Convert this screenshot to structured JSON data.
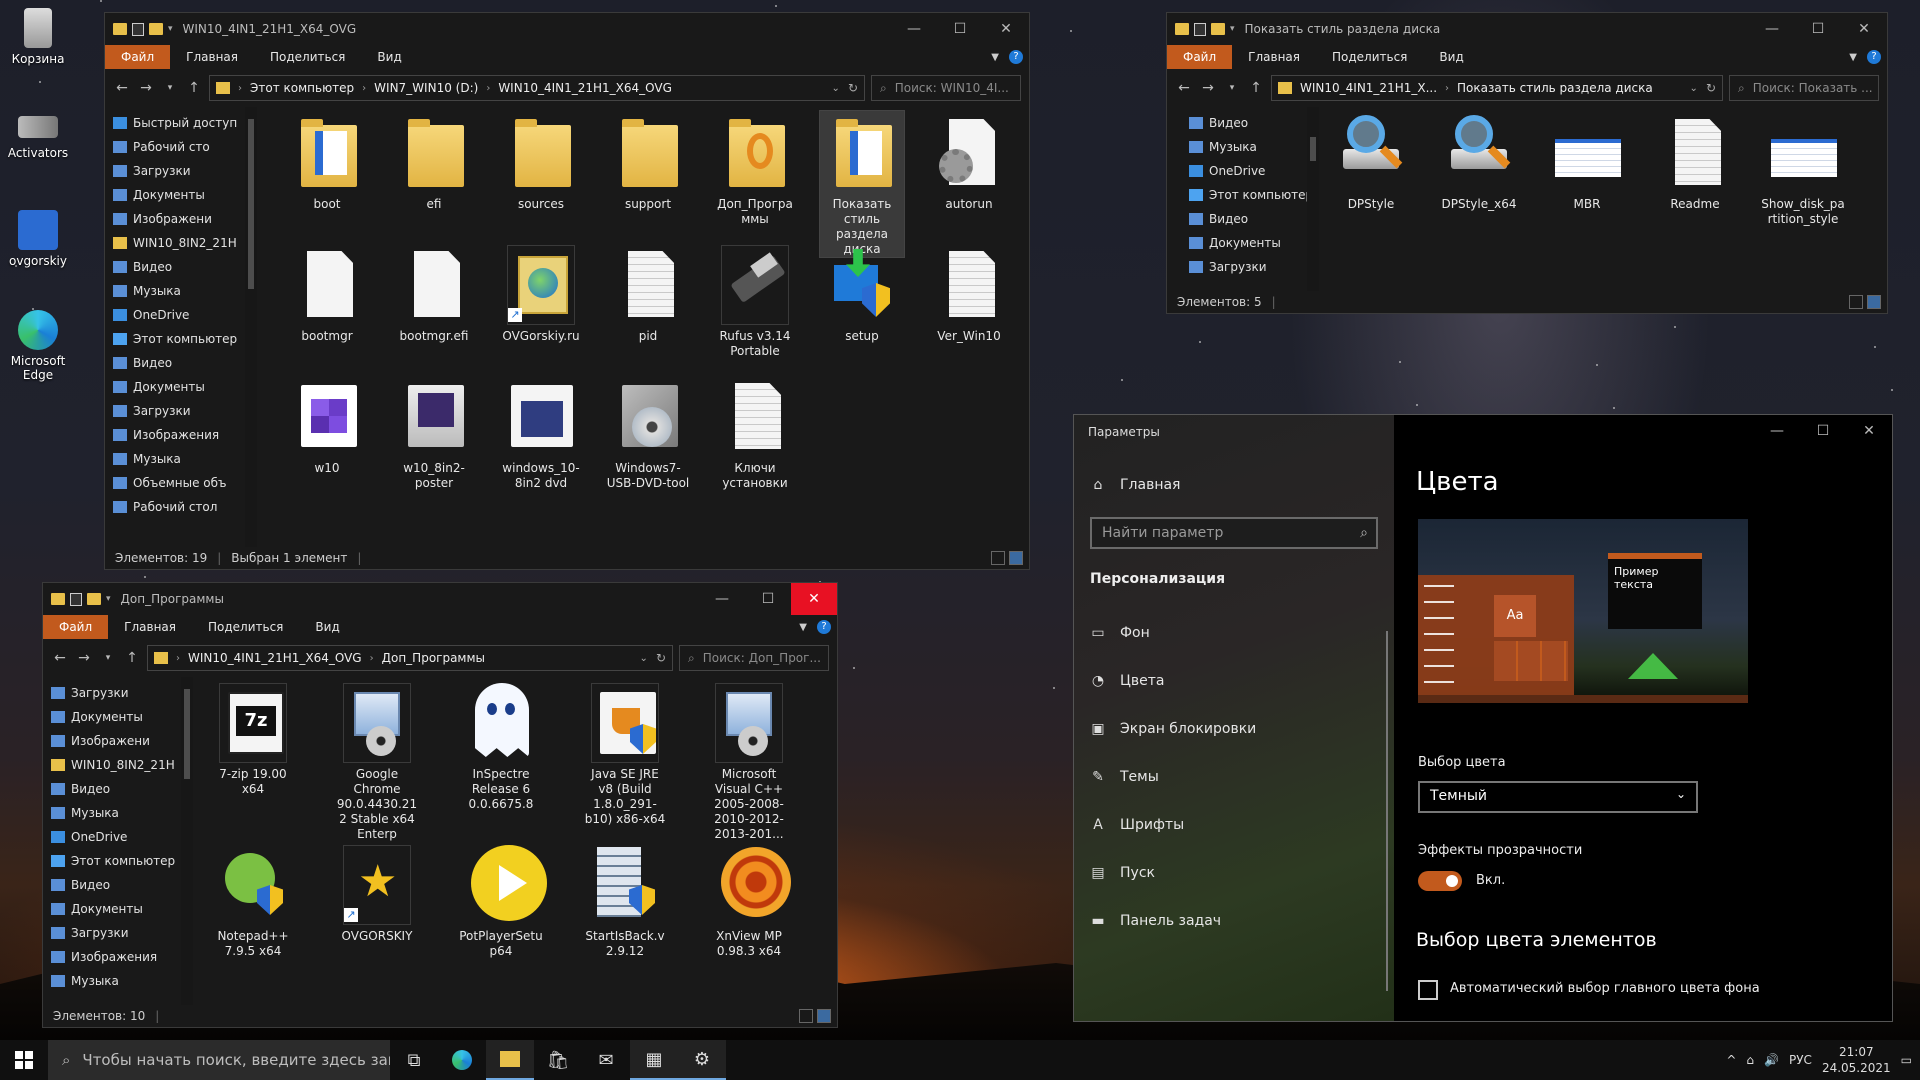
{
  "desktop": {
    "icons": [
      {
        "label": "Корзина",
        "icon": "recycle-bin-icon"
      },
      {
        "label": "Activators",
        "icon": "usb-plug-icon"
      },
      {
        "label": "ovgorskiy",
        "icon": "ovgorskiy-logo-icon"
      },
      {
        "label": "Microsoft Edge",
        "icon": "edge-icon"
      }
    ]
  },
  "explorer_main": {
    "title": "WIN10_4IN1_21H1_X64_OVG",
    "ribbon": {
      "file": "Файл",
      "home": "Главная",
      "share": "Поделиться",
      "view": "Вид"
    },
    "path": [
      "Этот компьютер",
      "WIN7_WIN10 (D:)",
      "WIN10_4IN1_21H1_X64_OVG"
    ],
    "search_placeholder": "Поиск: WIN10_4I...",
    "nav": [
      "Быстрый доступ",
      "Рабочий сто",
      "Загрузки",
      "Документы",
      "Изображени",
      "WIN10_8IN2_21H",
      "Видео",
      "Музыка",
      "OneDrive",
      "Этот компьютер",
      "Видео",
      "Документы",
      "Загрузки",
      "Изображения",
      "Музыка",
      "Объемные объ",
      "Рабочий стол"
    ],
    "items": [
      {
        "name": "boot",
        "kind": "folder-doc"
      },
      {
        "name": "efi",
        "kind": "folder"
      },
      {
        "name": "sources",
        "kind": "folder"
      },
      {
        "name": "support",
        "kind": "folder"
      },
      {
        "name": "Доп_Программы",
        "kind": "folder-app"
      },
      {
        "name": "Показать стиль раздела диска",
        "kind": "folder-doc"
      },
      {
        "name": "autorun",
        "kind": "config"
      },
      {
        "name": "bootmgr",
        "kind": "file"
      },
      {
        "name": "bootmgr.efi",
        "kind": "file"
      },
      {
        "name": "OVGorskiy.ru",
        "kind": "link"
      },
      {
        "name": "pid",
        "kind": "text"
      },
      {
        "name": "Rufus v3.14 Portable",
        "kind": "usb"
      },
      {
        "name": "setup",
        "kind": "setup"
      },
      {
        "name": "Ver_Win10",
        "kind": "text"
      },
      {
        "name": "w10",
        "kind": "win"
      },
      {
        "name": "w10_8in2-poster",
        "kind": "poster"
      },
      {
        "name": "windows_10-8in2 dvd",
        "kind": "dvd"
      },
      {
        "name": "Windows7-USB-DVD-tool",
        "kind": "box"
      },
      {
        "name": "Ключи установки",
        "kind": "text"
      }
    ],
    "status": {
      "count": "Элементов: 19",
      "selected": "Выбран 1 элемент"
    }
  },
  "explorer_disk": {
    "title": "Показать стиль раздела диска",
    "ribbon": {
      "file": "Файл",
      "home": "Главная",
      "share": "Поделиться",
      "view": "Вид"
    },
    "path": [
      "WIN10_4IN1_21H1_X...",
      "Показать стиль раздела диска"
    ],
    "search_placeholder": "Поиск: Показать ...",
    "nav": [
      "Видео",
      "Музыка",
      "OneDrive",
      "Этот компьютер",
      "Видео",
      "Документы",
      "Загрузки"
    ],
    "items": [
      {
        "name": "DPStyle",
        "kind": "magnifier"
      },
      {
        "name": "DPStyle_x64",
        "kind": "magnifier"
      },
      {
        "name": "MBR",
        "kind": "sheet"
      },
      {
        "name": "Readme",
        "kind": "text"
      },
      {
        "name": "Show_disk_partition_style",
        "kind": "sheet"
      }
    ],
    "status": {
      "count": "Элементов: 5"
    }
  },
  "explorer_apps": {
    "title": "Доп_Программы",
    "ribbon": {
      "file": "Файл",
      "home": "Главная",
      "share": "Поделиться",
      "view": "Вид"
    },
    "path": [
      "WIN10_4IN1_21H1_X64_OVG",
      "Доп_Программы"
    ],
    "search_placeholder": "Поиск: Доп_Прог...",
    "nav": [
      "Загрузки",
      "Документы",
      "Изображени",
      "WIN10_8IN2_21H",
      "Видео",
      "Музыка",
      "OneDrive",
      "Этот компьютер",
      "Видео",
      "Документы",
      "Загрузки",
      "Изображения",
      "Музыка"
    ],
    "items": [
      {
        "name": "7-zip 19.00 x64",
        "kind": "7zip"
      },
      {
        "name": "Google Chrome 90.0.4430.212 Stable x64 Enterp",
        "kind": "installer"
      },
      {
        "name": "InSpectre Release 6 0.0.6675.8",
        "kind": "ghost"
      },
      {
        "name": "Java SE JRE v8 (Build 1.8.0_291-b10) x86-x64",
        "kind": "java"
      },
      {
        "name": "Microsoft Visual C++ 2005-2008-2010-2012-2013-201...",
        "kind": "installer"
      },
      {
        "name": "Notepad++ 7.9.5 x64",
        "kind": "notepad"
      },
      {
        "name": "OVGORSKIY",
        "kind": "star"
      },
      {
        "name": "PotPlayerSetup64",
        "kind": "play"
      },
      {
        "name": "StartIsBack.v2.9.12",
        "kind": "startisback"
      },
      {
        "name": "XnView MP 0.98.3 x64",
        "kind": "xnview"
      }
    ],
    "status": {
      "count": "Элементов: 10"
    }
  },
  "settings": {
    "title": "Параметры",
    "home": "Главная",
    "search_placeholder": "Найти параметр",
    "section": "Персонализация",
    "menu": [
      "Фон",
      "Цвета",
      "Экран блокировки",
      "Темы",
      "Шрифты",
      "Пуск",
      "Панель задач"
    ],
    "page_title": "Цвета",
    "preview_text": "Пример текста",
    "preview_aa": "Aa",
    "color_choice_label": "Выбор цвета",
    "color_choice_value": "Темный",
    "transparency_label": "Эффекты прозрачности",
    "transparency_value": "Вкл.",
    "accent_title": "Выбор цвета элементов",
    "auto_accent_label": "Автоматический выбор главного цвета фона",
    "accent_color": "#c25a1d"
  },
  "taskbar": {
    "search_placeholder": "Чтобы начать поиск, введите здесь запрос",
    "lang": "РУС",
    "time": "21:07",
    "date": "24.05.2021"
  }
}
